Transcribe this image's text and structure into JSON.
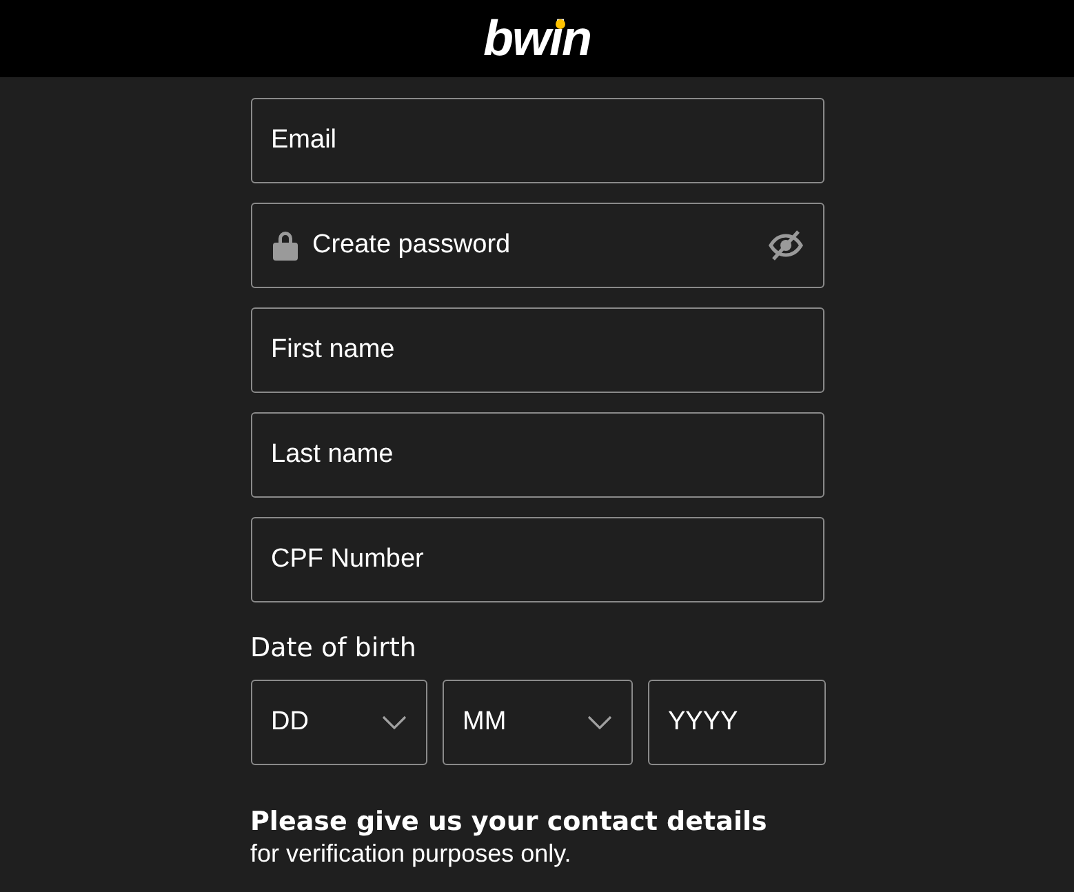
{
  "header": {
    "logo": "bwin"
  },
  "fields": [
    {
      "kind": "text",
      "placeholder": "Email"
    },
    {
      "kind": "password",
      "placeholder": "Create password"
    },
    {
      "kind": "text",
      "placeholder": "First name"
    },
    {
      "kind": "text",
      "placeholder": "Last name"
    },
    {
      "kind": "text",
      "placeholder": "CPF Number"
    }
  ],
  "date_of_birth": {
    "label": "Date of birth",
    "parts": [
      {
        "kind": "select",
        "placeholder": "DD"
      },
      {
        "kind": "select",
        "placeholder": "MM"
      },
      {
        "kind": "text",
        "placeholder": "YYYY"
      }
    ]
  },
  "contact": {
    "heading": "Please give us your contact details",
    "note": "for verification purposes only."
  }
}
